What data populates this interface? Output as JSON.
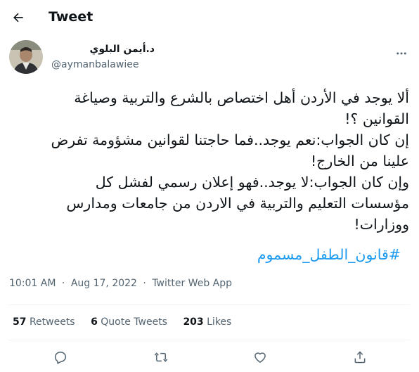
{
  "header": {
    "title": "Tweet"
  },
  "author": {
    "display_name": "د.أيمن البلوي",
    "handle": "@aymanbalawiee"
  },
  "tweet": {
    "lines": [
      "ألا يوجد في الأردن أهل اختصاص بالشرع والتربية وصياغة",
      "القوانين ؟!",
      "إن كان الجواب:نعم يوجد..فما حاجتنا لقوانين مشؤومة تفرض",
      "علينا من الخارج!",
      "وإن كان الجواب:لا يوجد..فهو إعلان رسمي لفشل كل",
      "مؤسسات التعليم والتربية في الاردن من جامعات ومدارس",
      "ووزارات!"
    ],
    "hashtag": "#قانون_الطفل_مسموم"
  },
  "meta": {
    "time": "10:01 AM",
    "date": "Aug 17, 2022",
    "source": "Twitter Web App",
    "separator": "·"
  },
  "stats": {
    "retweets_count": "57",
    "retweets_label": "Retweets",
    "quotes_count": "6",
    "quotes_label": "Quote Tweets",
    "likes_count": "203",
    "likes_label": "Likes"
  },
  "colors": {
    "link": "#1d9bf0",
    "secondary_text": "#536471",
    "divider": "#eff3f4"
  },
  "icons": [
    "back-arrow-icon",
    "more-icon",
    "reply-icon",
    "retweet-icon",
    "like-icon",
    "share-icon"
  ]
}
